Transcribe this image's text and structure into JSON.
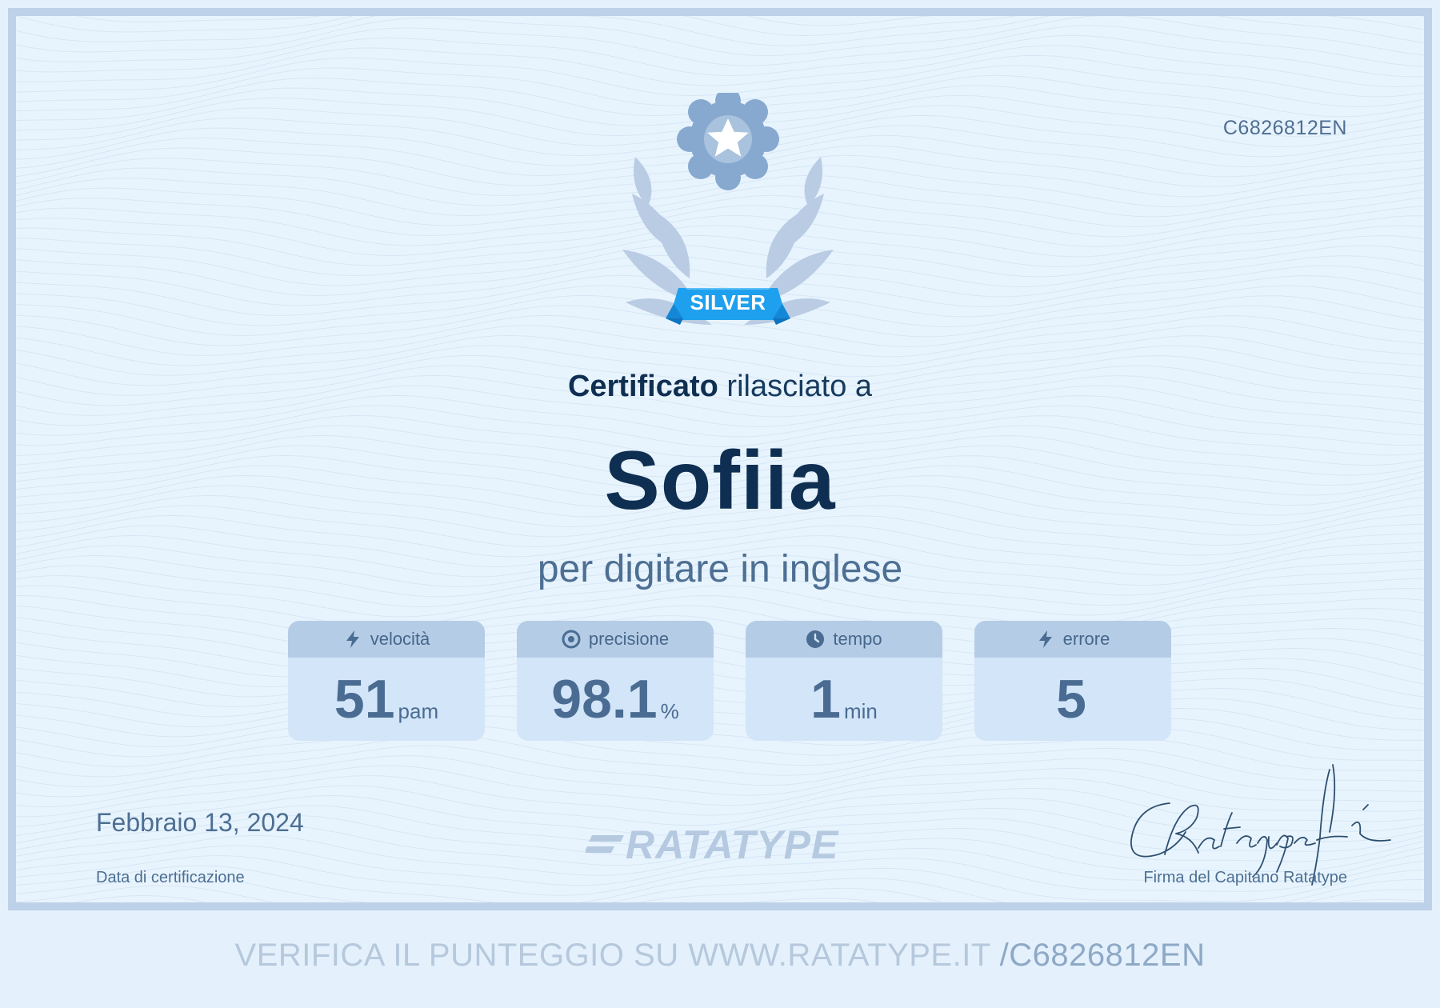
{
  "certificate": {
    "id": "C6826812EN",
    "medal": "SILVER",
    "issued_bold": "Certificato",
    "issued_rest": " rilasciato a",
    "recipient": "Sofiia",
    "subject": "per digitare in inglese"
  },
  "stats": [
    {
      "icon": "lightning-icon",
      "label": "velocità",
      "value": "51",
      "unit": "pam"
    },
    {
      "icon": "target-icon",
      "label": "precisione",
      "value": "98.1",
      "unit": "%"
    },
    {
      "icon": "clock-icon",
      "label": "tempo",
      "value": "1",
      "unit": "min"
    },
    {
      "icon": "lightning-icon",
      "label": "errore",
      "value": "5",
      "unit": ""
    }
  ],
  "footer": {
    "date": "Febbraio 13, 2024",
    "date_label": "Data di certificazione",
    "logo": "RATATYPE",
    "signature_label": "Firma del Capitano Ratatype"
  },
  "verify": {
    "prefix": "VERIFICA IL PUNTEGGIO SU WWW.RATATYPE.IT ",
    "code": "/C6826812EN"
  },
  "colors": {
    "border": "#bdd1e9",
    "background": "#e8f4fd",
    "ribbon": "#1ea0ee",
    "navy": "#0f2f52",
    "muted": "#4d6f93"
  }
}
